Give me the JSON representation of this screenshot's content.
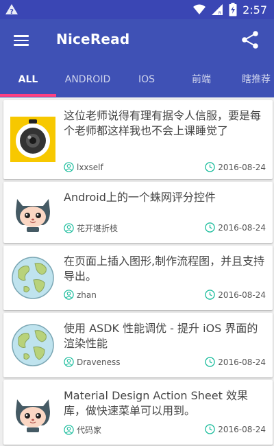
{
  "status_bar": {
    "time": "2:57"
  },
  "app_bar": {
    "title": "NiceRead"
  },
  "tabs": [
    {
      "label": "ALL",
      "active": true
    },
    {
      "label": "ANDROID",
      "active": false
    },
    {
      "label": "IOS",
      "active": false
    },
    {
      "label": "前端",
      "active": false
    },
    {
      "label": "瞎推荐",
      "active": false
    }
  ],
  "colors": {
    "primary": "#3f51b5",
    "status_bar": "#3a46b4",
    "indicator": "#ff4081",
    "meta_icon": "#1abc9c"
  },
  "articles": [
    {
      "title": "这位老师说得有理有据令人信服，要是每个老师都这样我也不会上课睡觉了",
      "author": "lxxself",
      "date": "2016-08-24",
      "thumbnail": "camera-lens-icon"
    },
    {
      "title": "Android上的一个蛛网评分控件",
      "author": "花开堪折枝",
      "date": "2016-08-24",
      "thumbnail": "octocat-icon"
    },
    {
      "title": "在页面上插入图形,制作流程图，并且支持导出。",
      "author": "zhan",
      "date": "2016-08-24",
      "thumbnail": "globe-icon"
    },
    {
      "title": "使用 ASDK 性能调优 - 提升 iOS 界面的渲染性能",
      "author": "Draveness",
      "date": "2016-08-24",
      "thumbnail": "globe-icon"
    },
    {
      "title": "Material Design Action Sheet 效果库，做快速菜单可以用到。",
      "author": "代码家",
      "date": "2016-08-24",
      "thumbnail": "octocat-icon"
    }
  ]
}
